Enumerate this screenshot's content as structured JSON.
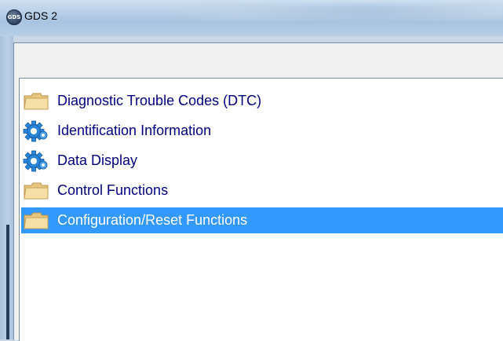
{
  "window": {
    "title": "GDS 2",
    "icon": "gds-app-icon",
    "icon_text": "GDS"
  },
  "tree": {
    "items": [
      {
        "label": "Diagnostic Trouble Codes (DTC)",
        "icon": "folder-icon",
        "selected": false
      },
      {
        "label": "Identification Information",
        "icon": "gear-icon",
        "selected": false
      },
      {
        "label": "Data Display",
        "icon": "gear-icon",
        "selected": false
      },
      {
        "label": "Control Functions",
        "icon": "folder-icon",
        "selected": false
      },
      {
        "label": "Configuration/Reset Functions",
        "icon": "folder-icon",
        "selected": true
      }
    ]
  },
  "colors": {
    "selection": "#3399ff",
    "item_text": "#000080",
    "selected_text": "#ffffff"
  }
}
